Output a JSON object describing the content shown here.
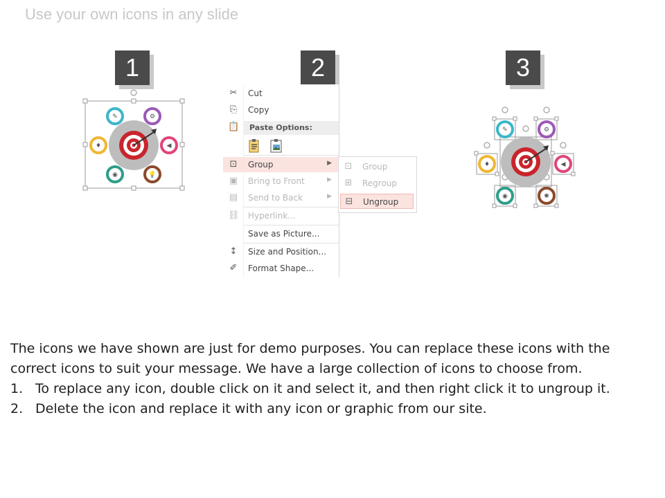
{
  "slide": {
    "title": "Use your own icons in any slide"
  },
  "steps": [
    "1",
    "2",
    "3"
  ],
  "context_menu": {
    "items": [
      {
        "label": "Cut",
        "icon": "scissors-icon",
        "disabled": false
      },
      {
        "label": "Copy",
        "icon": "copy-icon",
        "disabled": false
      },
      {
        "label": "Paste Options:",
        "icon": "clipboard-icon",
        "header": true
      },
      {
        "label": "Group",
        "icon": "group-icon",
        "disabled": false,
        "submenu": true,
        "highlighted": true
      },
      {
        "label": "Bring to Front",
        "icon": "bring-front-icon",
        "disabled": true,
        "submenu": true
      },
      {
        "label": "Send to Back",
        "icon": "send-back-icon",
        "disabled": true,
        "submenu": true
      },
      {
        "label": "Hyperlink...",
        "icon": "hyperlink-icon",
        "disabled": true
      },
      {
        "label": "Save as Picture...",
        "icon": "",
        "disabled": false
      },
      {
        "label": "Size and Position...",
        "icon": "size-position-icon",
        "disabled": false
      },
      {
        "label": "Format Shape...",
        "icon": "format-shape-icon",
        "disabled": false
      }
    ],
    "submenu": [
      {
        "label": "Group",
        "icon": "group-icon",
        "disabled": true
      },
      {
        "label": "Regroup",
        "icon": "regroup-icon",
        "disabled": true
      },
      {
        "label": "Ungroup",
        "icon": "ungroup-icon",
        "disabled": false,
        "highlighted": true
      }
    ]
  },
  "diagram": {
    "colors": {
      "teal": "#3bb7c9",
      "purple": "#9b59b6",
      "pink": "#e0457b",
      "yellow": "#f2b632",
      "green": "#2e9e8a",
      "brown": "#8b4a2b",
      "target_red": "#c9252c",
      "gray": "#bdbdbd"
    }
  },
  "body": {
    "intro": "The icons we have shown are just for demo purposes. You can replace these icons with the correct icons to suit your message. We have a large collection of icons to choose from.",
    "list": [
      {
        "num": "1.",
        "text": "To replace any icon, double click on it and select it, and then right click it to ungroup it."
      },
      {
        "num": "2.",
        "text": "Delete the icon and replace it with any icon or graphic from our site."
      }
    ]
  }
}
